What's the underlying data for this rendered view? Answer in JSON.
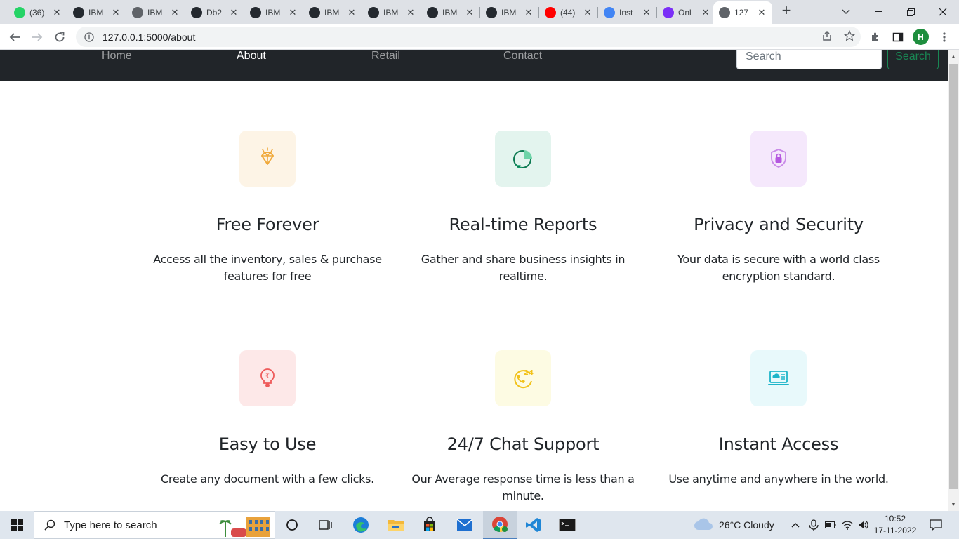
{
  "browser": {
    "tabs": [
      {
        "label": "(36)",
        "icon": "whatsapp-icon",
        "color": "#25d366"
      },
      {
        "label": "IBM",
        "icon": "github-icon",
        "color": "#24292f"
      },
      {
        "label": "IBM",
        "icon": "globe-icon",
        "color": "#5f6368"
      },
      {
        "label": "Db2",
        "icon": "db2-icon",
        "color": "#24292f"
      },
      {
        "label": "IBM",
        "icon": "github-icon",
        "color": "#24292f"
      },
      {
        "label": "IBM",
        "icon": "github-icon",
        "color": "#24292f"
      },
      {
        "label": "IBM",
        "icon": "github-icon",
        "color": "#24292f"
      },
      {
        "label": "IBM",
        "icon": "github-icon",
        "color": "#24292f"
      },
      {
        "label": "IBM",
        "icon": "github-icon",
        "color": "#24292f"
      },
      {
        "label": "(44)",
        "icon": "youtube-icon",
        "color": "#ff0000"
      },
      {
        "label": "Inst",
        "icon": "globe-icon",
        "color": "#4285f4"
      },
      {
        "label": "Onl",
        "icon": "picsart-icon",
        "color": "#7b2ff7"
      },
      {
        "label": "127",
        "icon": "globe-icon",
        "color": "#5f6368",
        "active": true
      }
    ],
    "url": "127.0.0.1:5000/about",
    "profile_initial": "H"
  },
  "nav": {
    "links": [
      "Home",
      "About",
      "Retail",
      "Contact"
    ],
    "active": "About",
    "search_placeholder": "Search",
    "search_button": "Search"
  },
  "features": [
    {
      "title": "Free Forever",
      "desc": "Access all the inventory, sales & purchase features for free",
      "icon": "diamond-icon",
      "bg": "#fdf4e6",
      "fg": "#f0a93b"
    },
    {
      "title": "Real-time Reports",
      "desc": "Gather and share business insights in realtime.",
      "icon": "pie-chart-icon",
      "bg": "#e3f4ee",
      "fg": "#13a06a"
    },
    {
      "title": "Privacy and Security",
      "desc": "Your data is secure with a world class encryption standard.",
      "icon": "shield-lock-icon",
      "bg": "#f5e8fc",
      "fg": "#b558e0"
    },
    {
      "title": "Easy to Use",
      "desc": "Create any document with a few clicks.",
      "icon": "rupee-bulb-icon",
      "bg": "#fde8e8",
      "fg": "#ee5a5a"
    },
    {
      "title": "24/7 Chat Support",
      "desc": "Our Average response time is less than a minute.",
      "icon": "support-24-icon",
      "bg": "#fdfbe3",
      "fg": "#f2c21a"
    },
    {
      "title": "Instant Access",
      "desc": "Use anytime and anywhere in the world.",
      "icon": "cloud-laptop-icon",
      "bg": "#e8f9fb",
      "fg": "#1eb5c9"
    }
  ],
  "taskbar": {
    "search_placeholder": "Type here to search",
    "weather": "26°C  Cloudy",
    "time": "10:52",
    "date": "17-11-2022"
  }
}
